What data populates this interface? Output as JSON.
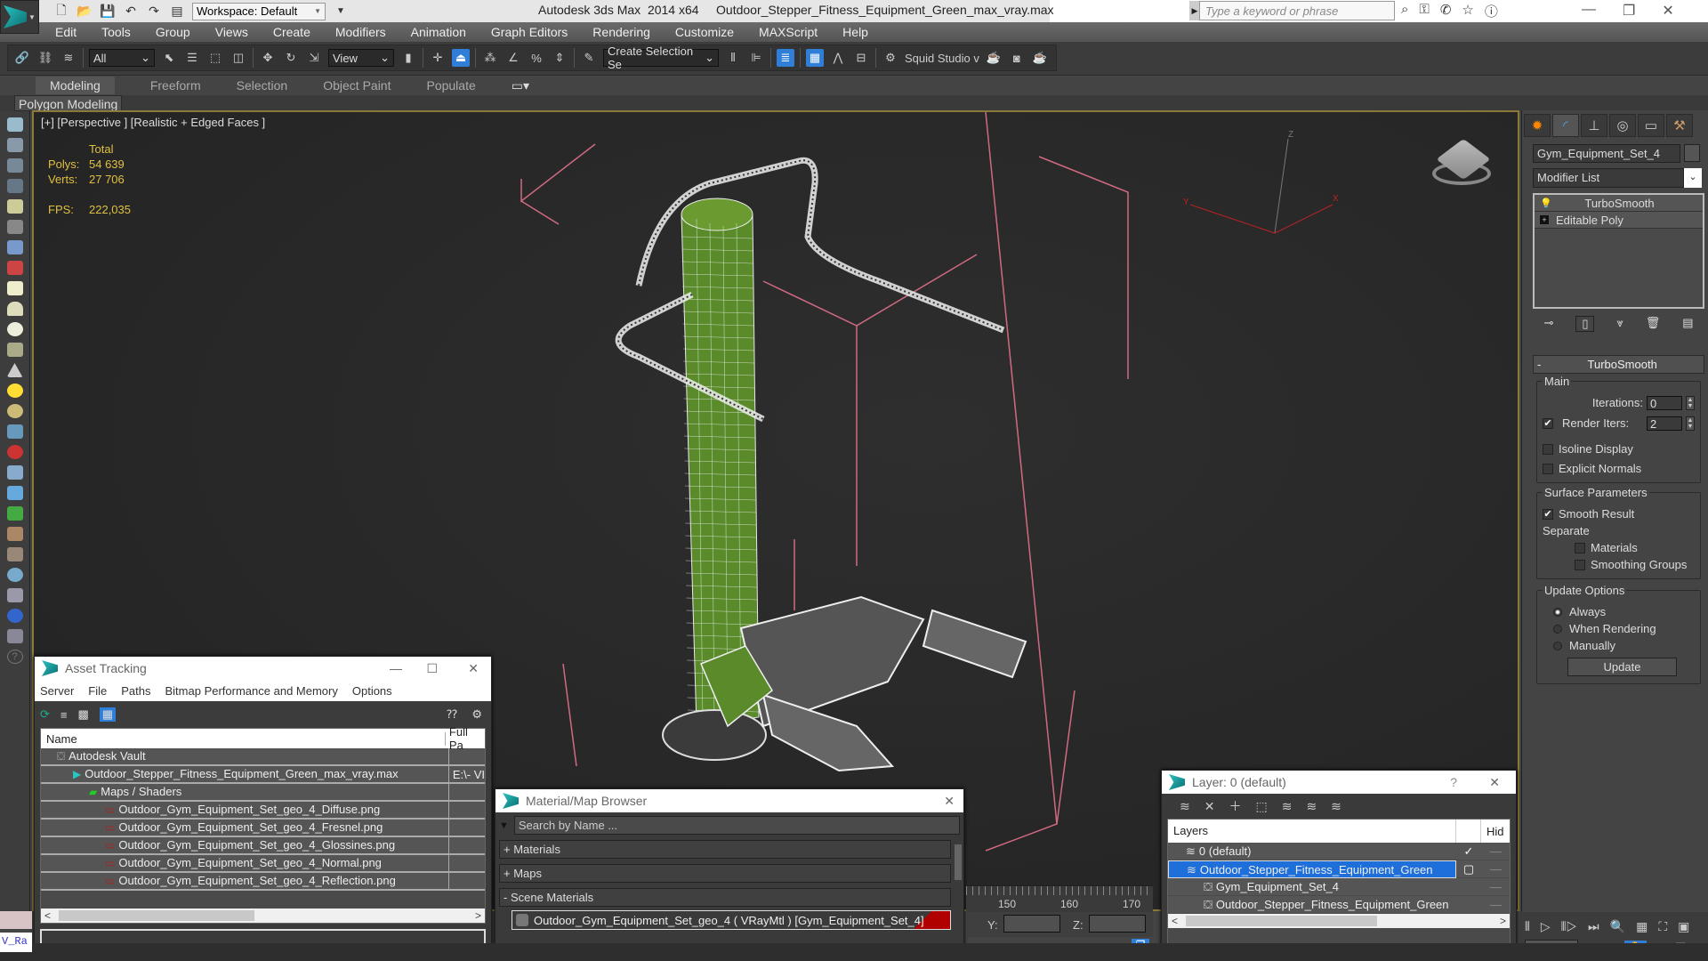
{
  "titlebar": {
    "workspace": "Workspace: Default",
    "app_name": "Autodesk 3ds Max  2014 x64",
    "file_name": "Outdoor_Stepper_Fitness_Equipment_Green_max_vray.max",
    "search_placeholder": "Type a keyword or phrase"
  },
  "menu": [
    "Edit",
    "Tools",
    "Group",
    "Views",
    "Create",
    "Modifiers",
    "Animation",
    "Graph Editors",
    "Rendering",
    "Customize",
    "MAXScript",
    "Help"
  ],
  "toolbar": {
    "selection_filter": "All",
    "ref_coord": "View",
    "named_selection": "Create Selection Se",
    "squid_label": "Squid Studio v"
  },
  "ribbon": {
    "tabs": [
      "Modeling",
      "Freeform",
      "Selection",
      "Object Paint",
      "Populate"
    ],
    "active_tab": "Modeling",
    "panel_tab": "Polygon Modeling"
  },
  "viewport": {
    "label": "[+] [Perspective ] [Realistic + Edged Faces ]",
    "stats": {
      "total_label": "Total",
      "polys_label": "Polys:",
      "polys": "54 639",
      "verts_label": "Verts:",
      "verts": "27 706",
      "fps_label": "FPS:",
      "fps": "222,035"
    },
    "axis": {
      "x": "X",
      "y": "Y",
      "z": "Z"
    }
  },
  "command_panel": {
    "object_name": "Gym_Equipment_Set_4",
    "modifier_list": "Modifier List",
    "stack": [
      {
        "label": "TurboSmooth",
        "icon": "lightbulb-icon"
      },
      {
        "label": "Editable Poly",
        "icon": "expand-icon"
      }
    ],
    "turbosmooth": {
      "title": "TurboSmooth",
      "collapse": "-",
      "main_group": "Main",
      "iterations_label": "Iterations:",
      "iterations": "0",
      "render_iters_label": "Render Iters:",
      "render_iters": "2",
      "render_iters_checked": true,
      "isoline_label": "Isoline Display",
      "isoline_checked": false,
      "explicit_normals_label": "Explicit Normals",
      "explicit_normals_checked": false,
      "surface_group": "Surface Parameters",
      "smooth_result_label": "Smooth Result",
      "smooth_result_checked": true,
      "separate_label": "Separate",
      "materials_label": "Materials",
      "materials_checked": false,
      "smoothing_groups_label": "Smoothing Groups",
      "smoothing_groups_checked": false,
      "update_group": "Update Options",
      "update_options": [
        "Always",
        "When Rendering",
        "Manually"
      ],
      "update_selected": "Always",
      "update_button": "Update"
    }
  },
  "asset_tracking": {
    "title": "Asset Tracking",
    "menu": [
      "Server",
      "File",
      "Paths",
      "Bitmap Performance and Memory",
      "Options"
    ],
    "columns": [
      "Name",
      "Full Pa"
    ],
    "rows": [
      {
        "name": "Autodesk Vault",
        "path": "",
        "indent": 1,
        "icon": "vault-icon"
      },
      {
        "name": "Outdoor_Stepper_Fitness_Equipment_Green_max_vray.max",
        "path": "E:\\- VI",
        "indent": 2,
        "icon": "max-file-icon"
      },
      {
        "name": "Maps / Shaders",
        "path": "",
        "indent": 3,
        "icon": "maps-icon"
      },
      {
        "name": "Outdoor_Gym_Equipment_Set_geo_4_Diffuse.png",
        "path": "",
        "indent": 4,
        "icon": "png-icon"
      },
      {
        "name": "Outdoor_Gym_Equipment_Set_geo_4_Fresnel.png",
        "path": "",
        "indent": 4,
        "icon": "png-icon"
      },
      {
        "name": "Outdoor_Gym_Equipment_Set_geo_4_Glossines.png",
        "path": "",
        "indent": 4,
        "icon": "png-icon"
      },
      {
        "name": "Outdoor_Gym_Equipment_Set_geo_4_Normal.png",
        "path": "",
        "indent": 4,
        "icon": "png-icon"
      },
      {
        "name": "Outdoor_Gym_Equipment_Set_geo_4_Reflection.png",
        "path": "",
        "indent": 4,
        "icon": "png-icon"
      }
    ]
  },
  "material_browser": {
    "title": "Material/Map Browser",
    "search_placeholder": "Search by Name ...",
    "sections": [
      "+ Materials",
      "+ Maps",
      "- Scene Materials"
    ],
    "scene_material": "Outdoor_Gym_Equipment_Set_geo_4  ( VRayMtl )  [Gym_Equipment_Set_4]"
  },
  "layer_dialog": {
    "title": "Layer: 0 (default)",
    "help": "?",
    "columns": [
      "Layers",
      "Hid"
    ],
    "rows": [
      {
        "name": "0 (default)",
        "indent": 1,
        "selected": false,
        "current": true
      },
      {
        "name": "Outdoor_Stepper_Fitness_Equipment_Green",
        "indent": 1,
        "selected": true,
        "current": false
      },
      {
        "name": "Gym_Equipment_Set_4",
        "indent": 2,
        "selected": false,
        "current": false
      },
      {
        "name": "Outdoor_Stepper_Fitness_Equipment_Green",
        "indent": 2,
        "selected": false,
        "current": false
      }
    ]
  },
  "timeline": {
    "ticks": [
      "150",
      "160",
      "170"
    ]
  },
  "coords": {
    "y_label": "Y:",
    "z_label": "Z:"
  },
  "status": {
    "maxscript_label": "V_Ra"
  }
}
